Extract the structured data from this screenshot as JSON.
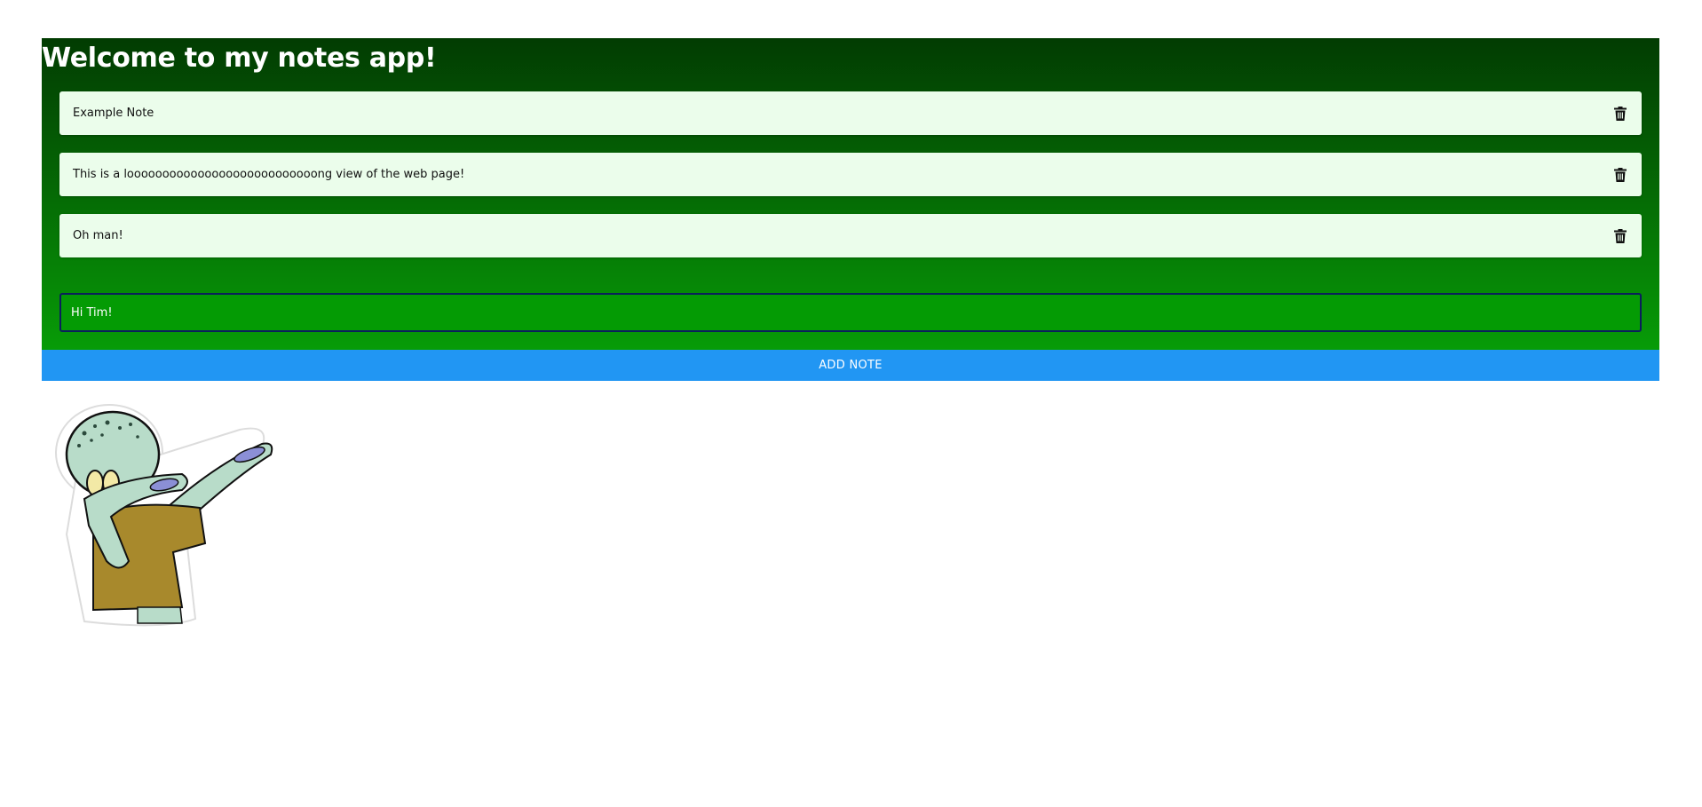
{
  "app": {
    "title": "Welcome to my notes app!"
  },
  "notes": [
    {
      "text": "Example Note",
      "delete_icon": "trash-icon"
    },
    {
      "text": "This is a looooooooooooooooooooooooooong view of the web page!",
      "delete_icon": "trash-icon"
    },
    {
      "text": "Oh man!",
      "delete_icon": "trash-icon"
    }
  ],
  "new_note": {
    "value": "Hi Tim!"
  },
  "add_button": {
    "label": "ADD NOTE"
  },
  "colors": {
    "header_dark": "#023c02",
    "header_light": "#079c07",
    "note_bg": "#ebfdeb",
    "button": "#2196f3"
  },
  "sticker": {
    "icon": "dabbing-squid-character-sticker"
  }
}
